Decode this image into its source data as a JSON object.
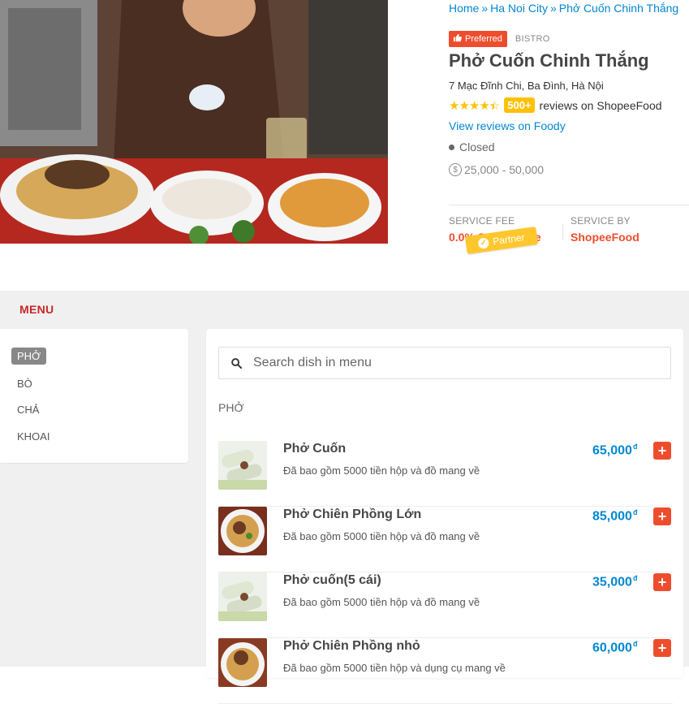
{
  "breadcrumb": {
    "home": "Home",
    "city": "Ha Noi City",
    "current": "Phở Cuốn Chinh Thắng",
    "separator": "»"
  },
  "restaurant": {
    "preferred_badge": "Preferred",
    "kind": "BISTRO",
    "name": "Phở Cuốn Chinh Thắng",
    "address": "7 Mạc Đĩnh Chi, Ba Đình, Hà Nội",
    "rating": 4.5,
    "review_count": "500+",
    "reviews_text": "reviews on ShopeeFood",
    "foody_link": "View reviews on Foody",
    "status": "Closed",
    "price_range": "25,000 - 50,000",
    "service_fee_label": "SERVICE FEE",
    "service_fee_value": "0.0% Service Fee",
    "service_by_label": "SERVICE BY",
    "service_by_value": "ShopeeFood",
    "partner_tag": "Partner"
  },
  "menu": {
    "title": "MENU",
    "categories": [
      {
        "label": "PHỞ",
        "active": true
      },
      {
        "label": "BÒ",
        "active": false
      },
      {
        "label": "CHẢ",
        "active": false
      },
      {
        "label": "KHOAI",
        "active": false
      }
    ],
    "search_placeholder": "Search dish in menu",
    "section_title": "PHỞ",
    "currency_symbol": "đ",
    "dishes": [
      {
        "name": "Phở Cuốn",
        "desc": "Đã bao gồm 5000 tiền hộp và đồ mang về",
        "price": "65,000"
      },
      {
        "name": "Phở Chiên Phồng Lớn",
        "desc": "Đã bao gồm 5000 tiền hộp và đồ mang về",
        "price": "85,000"
      },
      {
        "name": "Phở cuốn(5 cái)",
        "desc": "Đã bao gồm 5000 tiền hộp và đồ mang về",
        "price": "35,000"
      },
      {
        "name": "Phở Chiên Phồng nhỏ",
        "desc": "Đã bao gồm 5000 tiền hộp và dụng cụ mang về",
        "price": "60,000"
      }
    ]
  },
  "colors": {
    "accent_orange": "#ee4d2d",
    "link_blue": "#0288d1",
    "rating_yellow": "#ffc107",
    "menu_red": "#c62828"
  }
}
